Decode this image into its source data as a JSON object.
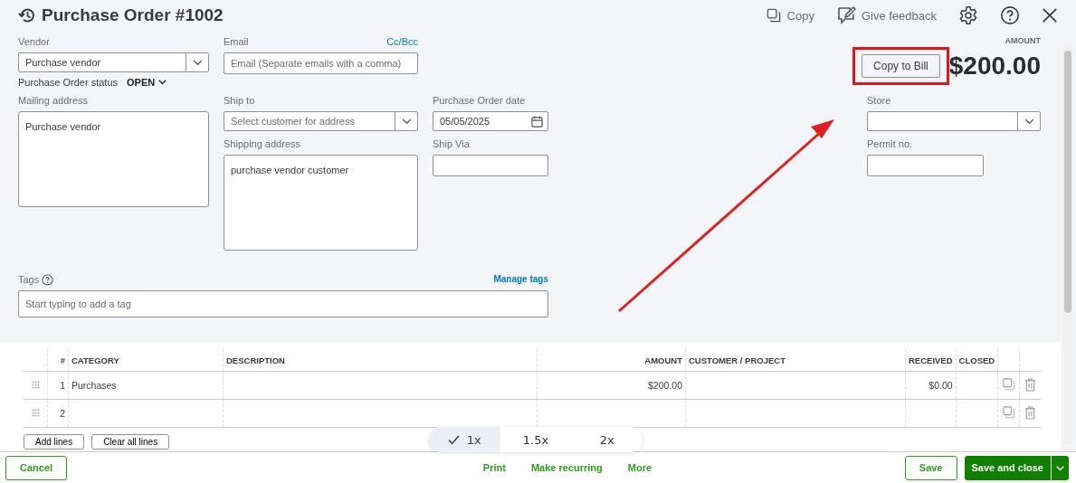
{
  "header": {
    "title": "Purchase Order #1002",
    "actions": [
      {
        "label": "Copy"
      },
      {
        "label": "Give feedback"
      }
    ]
  },
  "vendor": {
    "label": "Vendor",
    "value": "Purchase vendor"
  },
  "email": {
    "label": "Email",
    "link": "Cc/Bcc",
    "placeholder": "Email (Separate emails with a comma)"
  },
  "status": {
    "label": "Purchase Order status",
    "value": "OPEN"
  },
  "amount": {
    "label": "AMOUNT",
    "value": "$200.00",
    "button": "Copy to Bill"
  },
  "mailing_address": {
    "label": "Mailing address",
    "value": "Purchase vendor"
  },
  "ship_to": {
    "label": "Ship to",
    "placeholder": "Select customer for address"
  },
  "shipping_address": {
    "label": "Shipping address",
    "value": "purchase vendor customer"
  },
  "po_date": {
    "label": "Purchase Order date",
    "value": "05/05/2025"
  },
  "ship_via": {
    "label": "Ship Via"
  },
  "store": {
    "label": "Store"
  },
  "permit": {
    "label": "Permit no."
  },
  "tags": {
    "label": "Tags",
    "link": "Manage tags",
    "placeholder": "Start typing to add a tag"
  },
  "table": {
    "columns": [
      "#",
      "CATEGORY",
      "DESCRIPTION",
      "AMOUNT",
      "CUSTOMER / PROJECT",
      "RECEIVED",
      "CLOSED"
    ],
    "rows": [
      {
        "number": "1",
        "category": "Purchases",
        "amount": "$200.00",
        "received": "$0.00"
      },
      {
        "number": "2"
      }
    ]
  },
  "table_buttons": [
    "Add lines",
    "Clear all lines"
  ],
  "footer": {
    "cancel": "Cancel",
    "links": [
      "Print",
      "Make recurring",
      "More"
    ],
    "save": "Save",
    "save_close": "Save and close"
  },
  "zoom_options": [
    {
      "label": "1x",
      "selected": true
    },
    {
      "label": "1.5x",
      "selected": false
    },
    {
      "label": "2x",
      "selected": false
    }
  ]
}
